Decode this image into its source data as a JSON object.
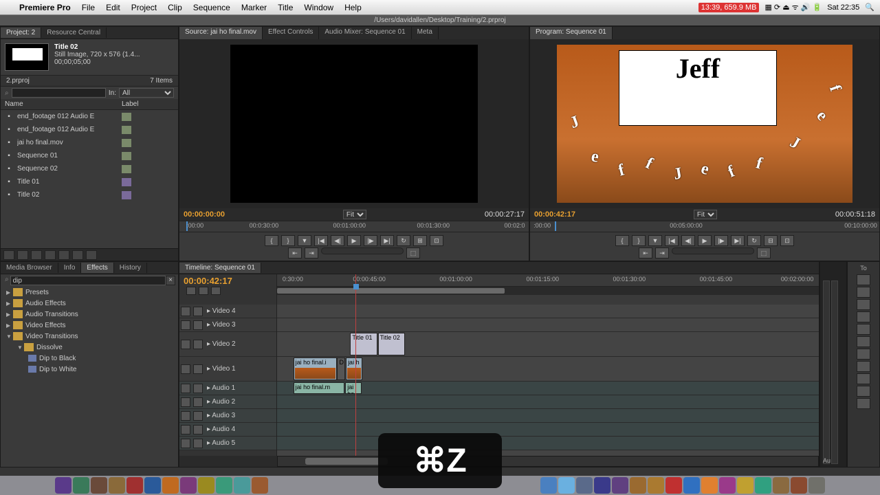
{
  "menubar": {
    "app": "Premiere Pro",
    "items": [
      "File",
      "Edit",
      "Project",
      "Clip",
      "Sequence",
      "Marker",
      "Title",
      "Window",
      "Help"
    ],
    "stats": "13:39, 659.9 MB",
    "clock": "Sat 22:35"
  },
  "window_title": "/Users/davidallen/Desktop/Training/2.prproj",
  "project": {
    "tab1": "Project: 2",
    "tab2": "Resource Central",
    "selected": {
      "name": "Title 02",
      "meta": "Still Image, 720 x 576 (1.4...",
      "dur": "00;00;05;00"
    },
    "file": "2.prproj",
    "count": "7 Items",
    "in_label": "In:",
    "in_value": "All",
    "col_name": "Name",
    "col_label": "Label",
    "items": [
      {
        "name": "end_footage 012 Audio E",
        "label": "green"
      },
      {
        "name": "end_footage 012 Audio E",
        "label": "green"
      },
      {
        "name": "jai ho final.mov",
        "label": "green"
      },
      {
        "name": "Sequence 01",
        "label": "green"
      },
      {
        "name": "Sequence 02",
        "label": "green"
      },
      {
        "name": "Title 01",
        "label": "purple"
      },
      {
        "name": "Title 02",
        "label": "purple"
      }
    ]
  },
  "source": {
    "tabs": [
      "Source: jai ho final.mov",
      "Effect Controls",
      "Audio Mixer: Sequence 01",
      "Meta"
    ],
    "tc_in": "00:00:00:00",
    "tc_out": "00:00:27:17",
    "fit": "Fit",
    "ruler": [
      {
        "pos": 2,
        "label": ":00:00"
      },
      {
        "pos": 20,
        "label": "00:0:30:00"
      },
      {
        "pos": 44,
        "label": "00:01:00:00"
      },
      {
        "pos": 68,
        "label": "00:01:30:00"
      },
      {
        "pos": 93,
        "label": "00:02:0"
      }
    ]
  },
  "program": {
    "tab": "Program: Sequence 01",
    "tc_in": "00:00:42:17",
    "tc_out": "00:00:51:18",
    "fit": "Fit",
    "card_text": "Jeff",
    "ruler": [
      {
        "pos": 1,
        "label": ":00:00"
      },
      {
        "pos": 40,
        "label": "00:05:00:00"
      },
      {
        "pos": 90,
        "label": "00:10:00:00"
      }
    ]
  },
  "effects": {
    "tabs": [
      "Media Browser",
      "Info",
      "Effects",
      "History"
    ],
    "search": "dip",
    "folders": [
      {
        "name": "Presets",
        "open": false,
        "indent": 0
      },
      {
        "name": "Audio Effects",
        "open": false,
        "indent": 0
      },
      {
        "name": "Audio Transitions",
        "open": false,
        "indent": 0
      },
      {
        "name": "Video Effects",
        "open": false,
        "indent": 0
      },
      {
        "name": "Video Transitions",
        "open": true,
        "indent": 0
      },
      {
        "name": "Dissolve",
        "open": true,
        "indent": 1
      }
    ],
    "items": [
      "Dip to Black",
      "Dip to White"
    ]
  },
  "timeline": {
    "tab": "Timeline: Sequence 01",
    "tc": "00:00:42:17",
    "ruler": [
      {
        "pos": 1,
        "label": "0:30:00"
      },
      {
        "pos": 14,
        "label": "00:00:45:00"
      },
      {
        "pos": 30,
        "label": "00:01:00:00"
      },
      {
        "pos": 46,
        "label": "00:01:15:00"
      },
      {
        "pos": 62,
        "label": "00:01:30:00"
      },
      {
        "pos": 78,
        "label": "00:01:45:00"
      },
      {
        "pos": 93,
        "label": "00:02:00:00"
      }
    ],
    "tracks_v": [
      "Video 4",
      "Video 3",
      "Video 2",
      "Video 1"
    ],
    "tracks_a": [
      "Audio 1",
      "Audio 2",
      "Audio 3",
      "Audio 4",
      "Audio 5"
    ],
    "clips": {
      "title01": "Title 01",
      "title02": "Title 02",
      "v1a": "jai ho final.i",
      "v1b": "D",
      "v1c": "jai h",
      "a1a": "jai ho final.m",
      "a1b": "jai ho"
    }
  },
  "tools": {
    "label_au": "Au",
    "label_to": "To"
  },
  "shortcut": "⌘Z",
  "dock_colors": [
    "#4a80c0",
    "#6ab0e0",
    "#5a6a8a",
    "#3a3a8a",
    "#604080",
    "#9a6a30",
    "#aa7a30",
    "#c03030",
    "#3070c0",
    "#e08030",
    "#9a3a8a",
    "#c0a030",
    "#30a080",
    "#8a6a40",
    "#8a4a30",
    "#70706a"
  ]
}
